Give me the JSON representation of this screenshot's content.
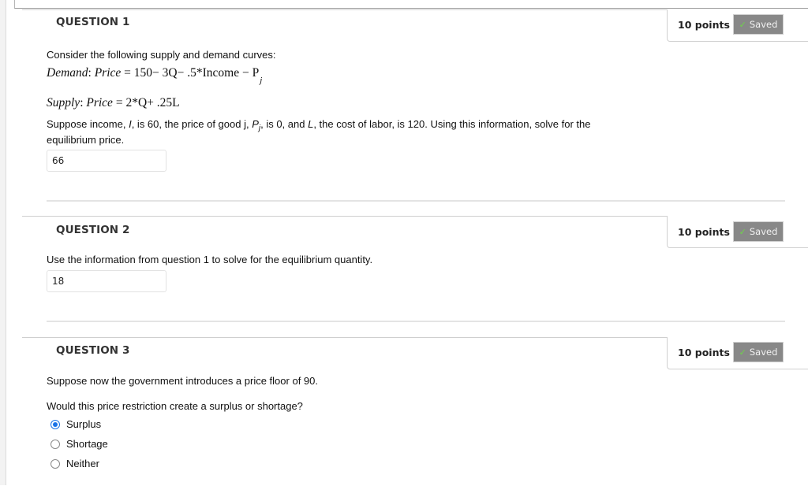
{
  "questions": [
    {
      "title": "QUESTION 1",
      "points": "10 points",
      "status": "Saved",
      "intro": "Consider the following supply and demand curves:",
      "demand_equation": {
        "label": "Demand",
        "lhs": "Price",
        "rhs": "150− 3Q− .5*Income − P",
        "subscript": "j"
      },
      "supply_equation": {
        "label": "Supply",
        "lhs": "Price",
        "rhs": "2*Q+ .25L"
      },
      "prompt_parts": [
        " Suppose income, ",
        "I",
        ", is 60, the price of good j, ",
        "P",
        "j",
        ", is 0, and ",
        "L",
        ", the cost of labor, is 120. Using this information, solve for the"
      ],
      "prompt_line2": "equilibrium price.",
      "answer": "66"
    },
    {
      "title": "QUESTION 2",
      "points": "10 points",
      "status": "Saved",
      "prompt": "Use the information from question 1 to solve for the equilibrium quantity.",
      "answer": "18"
    },
    {
      "title": "QUESTION 3",
      "points": "10 points",
      "status": "Saved",
      "prompt": "Suppose now the government introduces a price floor of 90.",
      "subprompt": "Would this price restriction create a surplus or shortage?",
      "options": [
        {
          "label": "Surplus",
          "selected": true
        },
        {
          "label": "Shortage",
          "selected": false
        },
        {
          "label": "Neither",
          "selected": false
        }
      ]
    }
  ],
  "colors": {
    "saved_badge_bg": "#888888",
    "check": "#6ed34a",
    "radio_selected": "#1a73e8"
  }
}
